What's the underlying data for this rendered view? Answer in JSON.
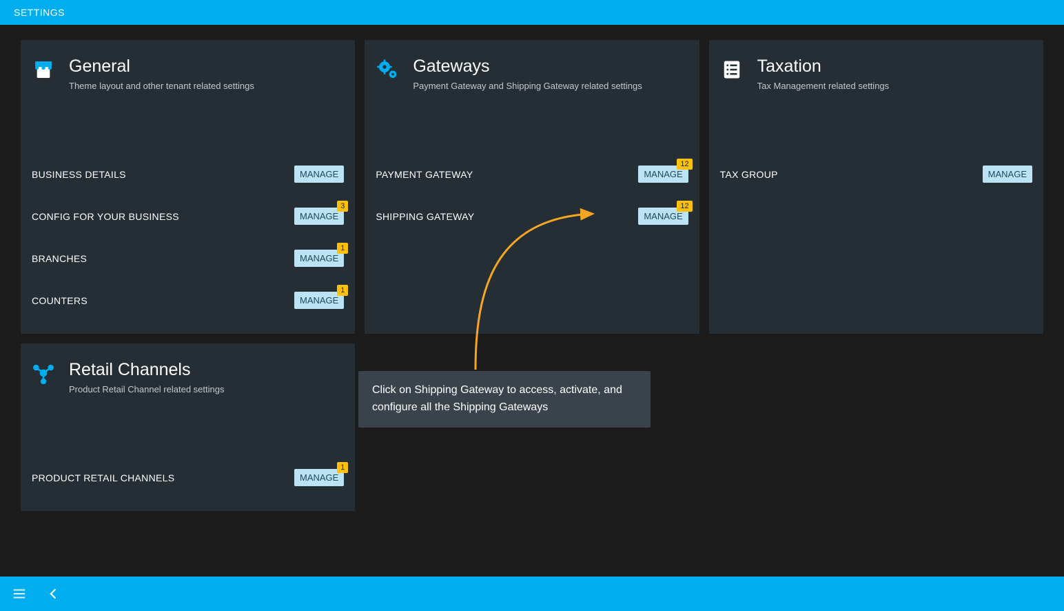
{
  "header": {
    "title": "SETTINGS"
  },
  "manage_label": "MANAGE",
  "cards": {
    "general": {
      "title": "General",
      "subtitle": "Theme layout and other tenant related settings",
      "items": [
        {
          "label": "BUSINESS DETAILS",
          "badge": null
        },
        {
          "label": "CONFIG FOR YOUR BUSINESS",
          "badge": "3"
        },
        {
          "label": "BRANCHES",
          "badge": "1"
        },
        {
          "label": "COUNTERS",
          "badge": "1"
        }
      ]
    },
    "gateways": {
      "title": "Gateways",
      "subtitle": "Payment Gateway and Shipping Gateway related settings",
      "items": [
        {
          "label": "PAYMENT GATEWAY",
          "badge": "12"
        },
        {
          "label": "SHIPPING GATEWAY",
          "badge": "12"
        }
      ]
    },
    "taxation": {
      "title": "Taxation",
      "subtitle": "Tax Management related settings",
      "items": [
        {
          "label": "TAX GROUP",
          "badge": null
        }
      ]
    },
    "retail": {
      "title": "Retail Channels",
      "subtitle": "Product Retail Channel related settings",
      "items": [
        {
          "label": "PRODUCT RETAIL CHANNELS",
          "badge": "1"
        }
      ]
    }
  },
  "tooltip": {
    "text": "Click on Shipping Gateway to access, activate, and configure all the Shipping Gateways"
  }
}
